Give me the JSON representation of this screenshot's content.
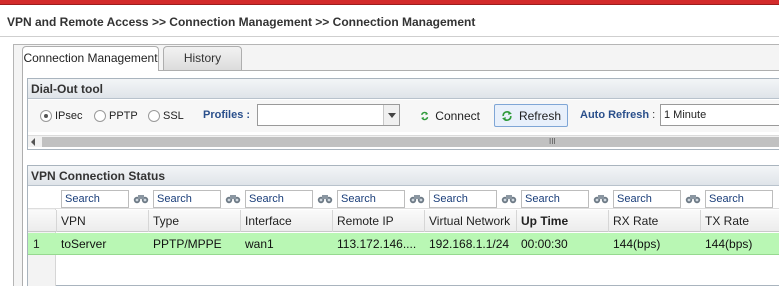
{
  "breadcrumb": "VPN and Remote Access >> Connection Management >> Connection Management",
  "tabs": [
    {
      "label": "Connection Management",
      "active": true
    },
    {
      "label": "History",
      "active": false
    }
  ],
  "dialout": {
    "title": "Dial-Out tool",
    "protocols": [
      {
        "label": "IPsec",
        "selected": true
      },
      {
        "label": "PPTP",
        "selected": false
      },
      {
        "label": "SSL",
        "selected": false
      }
    ],
    "profiles_label": "Profiles :",
    "profiles_value": "",
    "connect_label": "Connect",
    "refresh_label": "Refresh",
    "auto_refresh_label": "Auto Refresh",
    "auto_refresh_sep": ":",
    "auto_refresh_value": "1 Minute",
    "scroll_grip": "III"
  },
  "status": {
    "title": "VPN Connection Status",
    "search_placeholder": "Search",
    "columns": [
      "VPN",
      "Type",
      "Interface",
      "Remote IP",
      "Virtual Network",
      "Up Time",
      "RX Rate",
      "TX Rate"
    ],
    "rows": [
      {
        "num": "1",
        "vpn": "toServer",
        "type": "PPTP/MPPE",
        "interface": "wan1",
        "remote_ip": "113.172.146....",
        "virtual_network": "192.168.1.1/24",
        "up_time": "00:00:30",
        "rx_rate": "144(bps)",
        "tx_rate": "144(bps)"
      }
    ]
  },
  "colors": {
    "accent_bar": "#d32b2b",
    "label_blue": "#2a4f8b",
    "row_highlight": "#b9f7b4",
    "icon_green": "#2e9a3a"
  }
}
